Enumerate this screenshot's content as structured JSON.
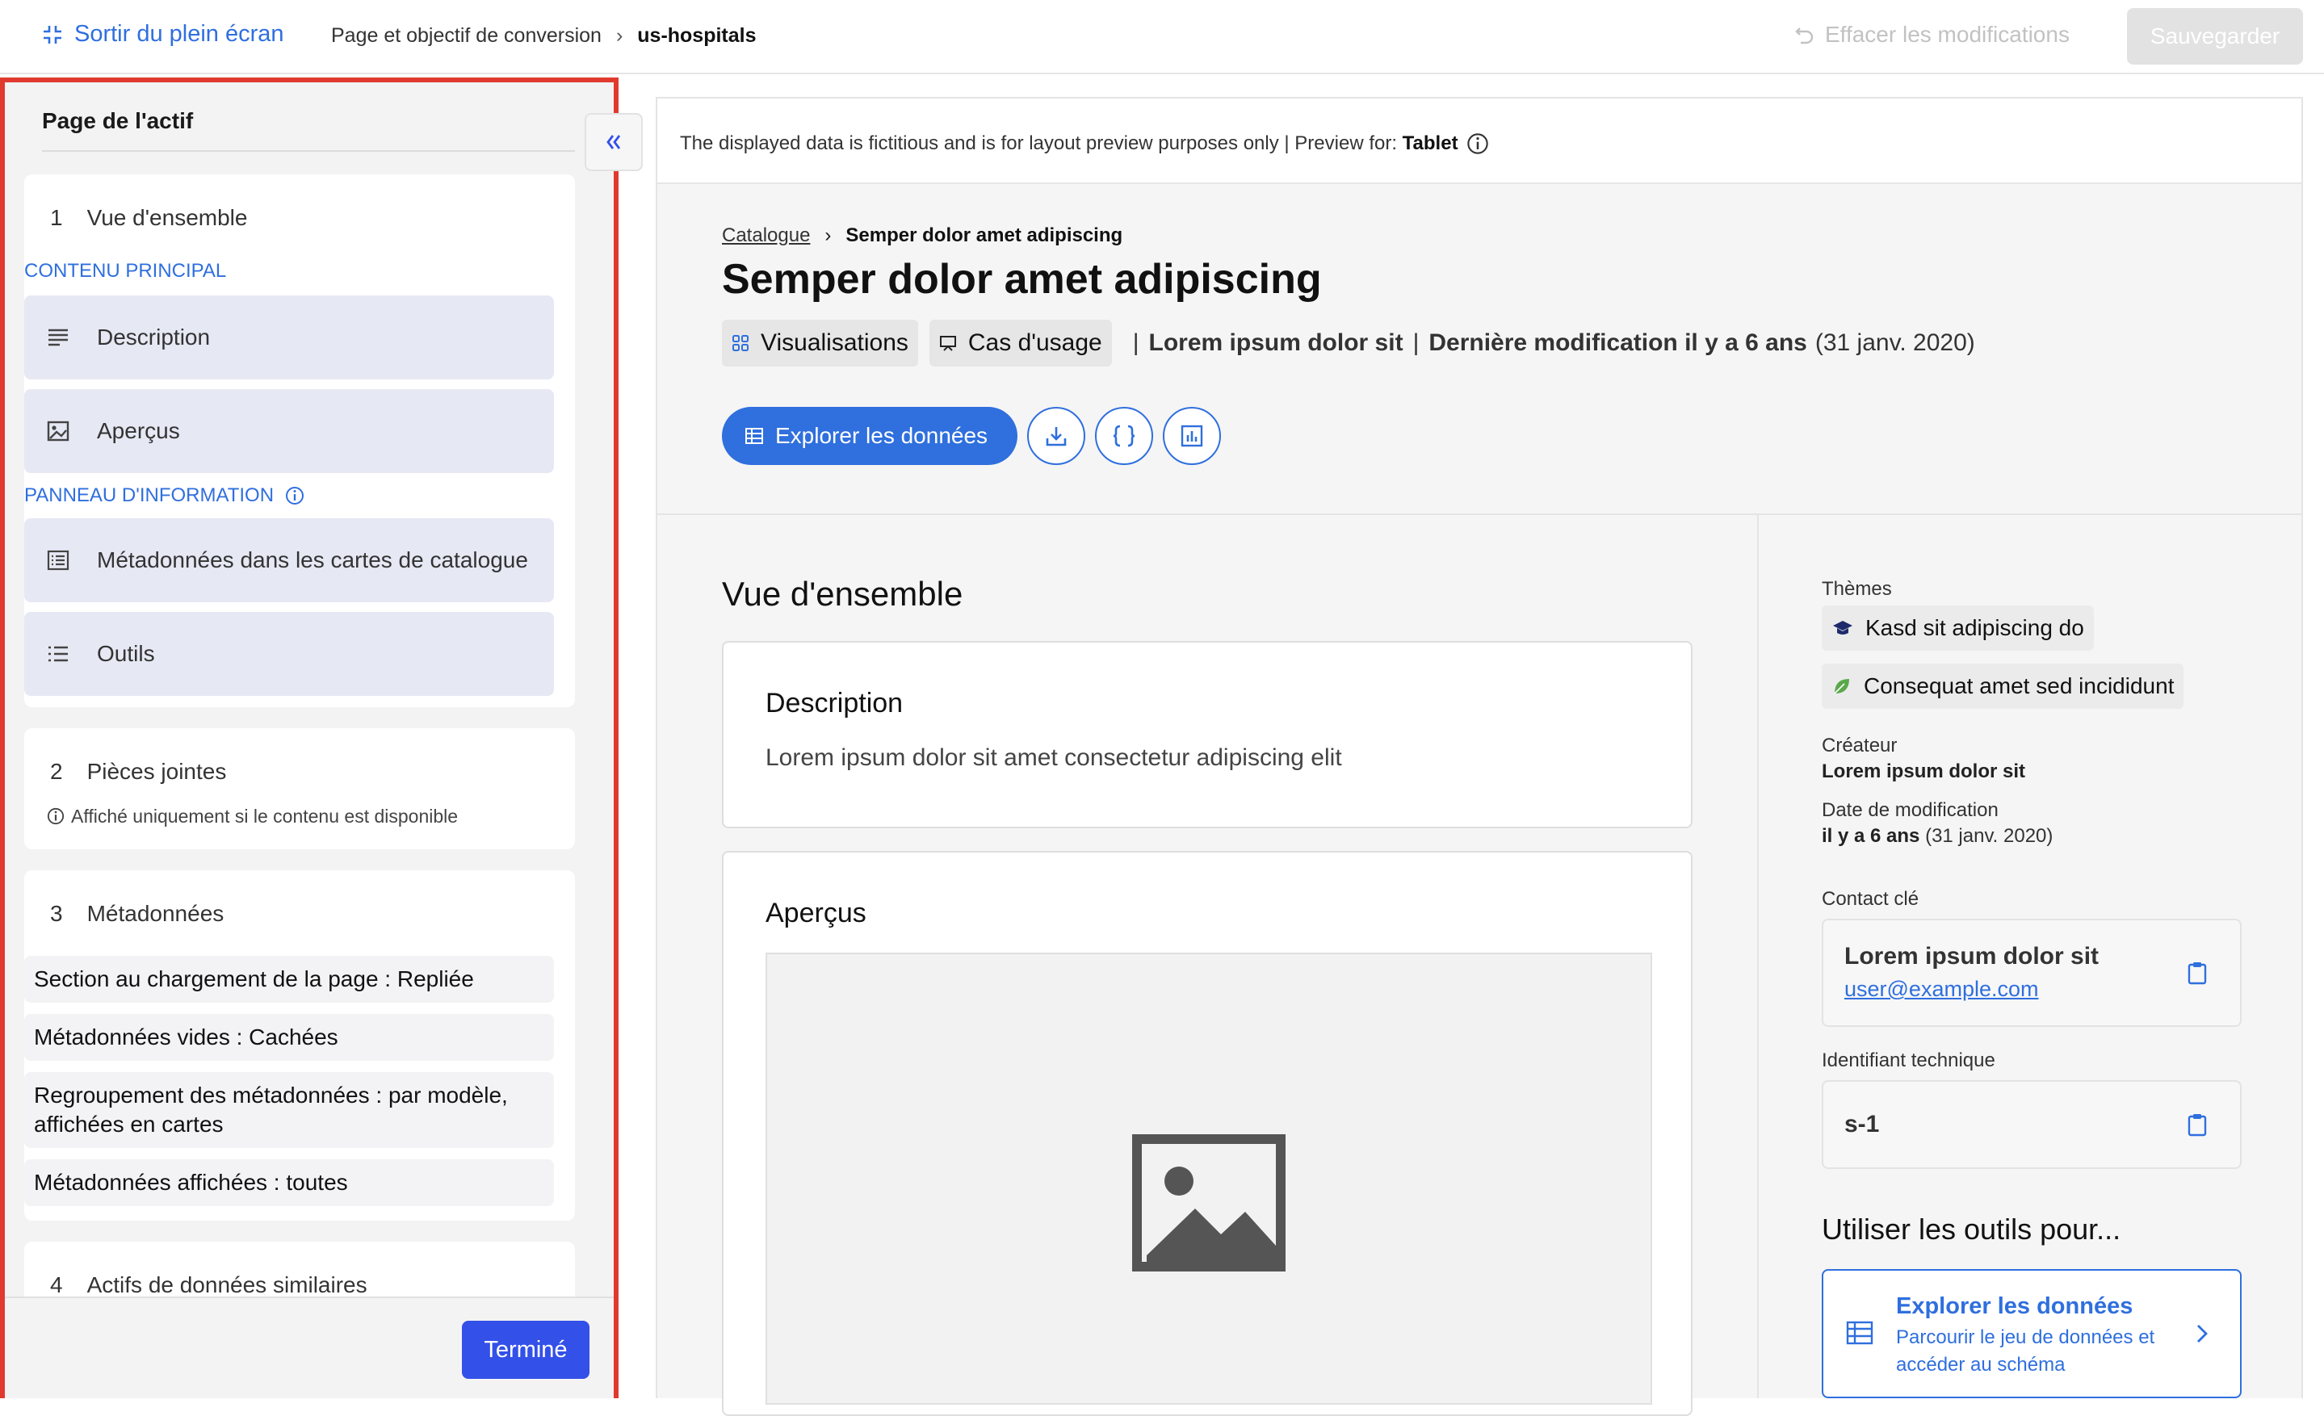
{
  "topbar": {
    "exit_fullscreen": "Sortir du plein écran",
    "breadcrumb_parent": "Page et objectif de conversion",
    "breadcrumb_current": "us-hospitals",
    "reset_label": "Effacer les modifications",
    "save_label": "Sauvegarder"
  },
  "left_panel": {
    "title": "Page de l'actif",
    "sections": [
      {
        "num": "1",
        "title": "Vue d'ensemble",
        "group1_label": "CONTENU PRINCIPAL",
        "group1_items": [
          "Description",
          "Aperçus"
        ],
        "group2_label": "PANNEAU D'INFORMATION",
        "group2_items": [
          "Métadonnées dans les cartes de catalogue",
          "Outils"
        ]
      },
      {
        "num": "2",
        "title": "Pièces jointes",
        "note": "Affiché uniquement si le contenu est disponible"
      },
      {
        "num": "3",
        "title": "Métadonnées",
        "items": [
          "Section au chargement de la page : Repliée",
          "Métadonnées vides : Cachées",
          "Regroupement des métadonnées : par modèle, affichées en cartes",
          "Métadonnées affichées : toutes"
        ]
      },
      {
        "num": "4",
        "title": "Actifs de données similaires"
      }
    ],
    "done_label": "Terminé"
  },
  "preview": {
    "banner_text": "The displayed data is fictitious and is for layout preview purposes only | Preview for: ",
    "banner_device": "Tablet",
    "breadcrumb_parent": "Catalogue",
    "breadcrumb_current": "Semper dolor amet adipiscing",
    "title": "Semper dolor amet adipiscing",
    "tag1": "Visualisations",
    "tag2": "Cas d'usage",
    "publisher": "Lorem ipsum dolor sit",
    "modified_bold": "Dernière modification il y a 6 ans",
    "modified_date": "(31 janv. 2020)",
    "explore_button": "Explorer les données",
    "overview_heading": "Vue d'ensemble",
    "description_title": "Description",
    "description_text": "Lorem ipsum dolor sit amet consectetur adipiscing elit",
    "previews_title": "Aperçus",
    "side": {
      "themes_label": "Thèmes",
      "theme1": "Kasd sit adipiscing do",
      "theme2": "Consequat amet sed incididunt",
      "creator_label": "Créateur",
      "creator_value": "Lorem ipsum dolor sit",
      "modified_label": "Date de modification",
      "modified_bold": "il y a 6 ans",
      "modified_date": "(31 janv. 2020)",
      "contact_label": "Contact clé",
      "contact_name": "Lorem ipsum dolor sit",
      "contact_email": "user@example.com",
      "technical_id_label": "Identifiant technique",
      "technical_id_value": "s-1",
      "tools_heading": "Utiliser les outils pour...",
      "tool_title": "Explorer les données",
      "tool_desc": "Parcourir le jeu de données et accéder au schéma"
    }
  },
  "colors": {
    "accent": "#2f6fde",
    "done_button": "#3350e8",
    "highlight_border": "#e03a2e",
    "item_bg": "#e6e8f4"
  }
}
